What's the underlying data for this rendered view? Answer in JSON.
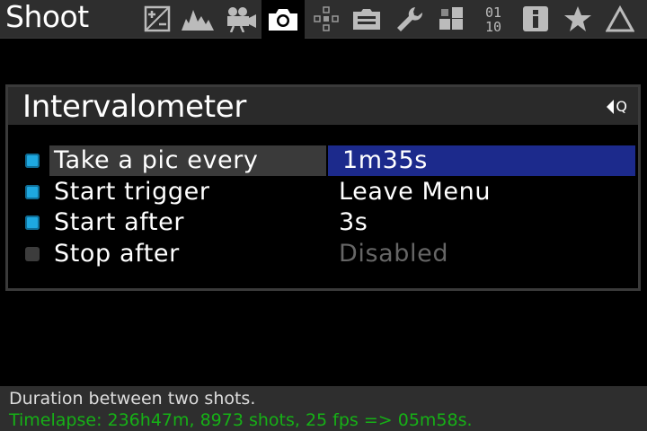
{
  "menu_title": "Shoot",
  "tabs": [
    {
      "name": "exposure-tab",
      "icon": "exposure-compensation-icon"
    },
    {
      "name": "histogram-tab",
      "icon": "histogram-icon"
    },
    {
      "name": "movie-tab",
      "icon": "movie-camera-icon"
    },
    {
      "name": "shoot-tab",
      "icon": "camera-icon",
      "active": true
    },
    {
      "name": "focus-tab",
      "icon": "focus-points-icon"
    },
    {
      "name": "display-tab",
      "icon": "display-icon"
    },
    {
      "name": "prefs-tab",
      "icon": "wrench-icon"
    },
    {
      "name": "modules-tab",
      "icon": "modules-icon"
    },
    {
      "name": "debug-tab",
      "icon": "binary-icon",
      "text": "01\n10"
    },
    {
      "name": "info-tab",
      "icon": "info-icon"
    },
    {
      "name": "mymenu-tab",
      "icon": "star-icon"
    },
    {
      "name": "delta-tab",
      "icon": "delta-icon"
    }
  ],
  "panel": {
    "title": "Intervalometer",
    "q_hint": "Q",
    "rows": [
      {
        "label": "Take a pic every",
        "value": "1m35s",
        "enabled": true,
        "selected": true
      },
      {
        "label": "Start trigger",
        "value": "Leave Menu",
        "enabled": true,
        "selected": false
      },
      {
        "label": "Start after",
        "value": "3s",
        "enabled": true,
        "selected": false
      },
      {
        "label": "Stop after",
        "value": "Disabled",
        "enabled": false,
        "selected": false
      }
    ]
  },
  "help": {
    "line1": "Duration between two shots.",
    "line2": "Timelapse: 236h47m, 8973 shots, 25 fps => 05m58s."
  },
  "colors": {
    "accent_bullet": "#1ea8e0",
    "selected_value_bg": "#1c2a8c",
    "help_green": "#16b016"
  }
}
